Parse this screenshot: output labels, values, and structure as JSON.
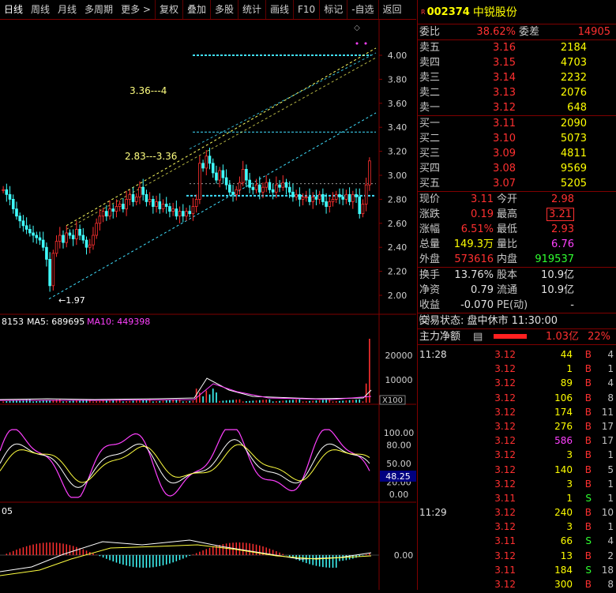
{
  "toolbar": {
    "tabs": [
      "日线",
      "周线",
      "月线",
      "多周期",
      "更多 >"
    ],
    "tools": [
      "复权",
      "叠加",
      "多股",
      "统计",
      "画线",
      "F10",
      "标记",
      "-自选",
      "返回"
    ]
  },
  "price_axis": [
    "4.00",
    "3.80",
    "3.60",
    "3.40",
    "3.20",
    "3.00",
    "2.80",
    "2.60",
    "2.40",
    "2.20",
    "2.00"
  ],
  "annotations": {
    "top_range": "3.36---4",
    "mid_range": "2.83---3.36",
    "low_mark": "1.97"
  },
  "volume_panel": {
    "legend_vol": "8153",
    "legend_ma5": "MA5: 689695",
    "legend_ma10": "MA10: 449398",
    "axis": [
      "20000",
      "10000"
    ],
    "unit": "X100"
  },
  "kdj_panel": {
    "axis": [
      "100.00",
      "80.00",
      "50.00",
      "20.00",
      "0.00"
    ],
    "current": "48.25"
  },
  "macd_panel": {
    "legend": "05",
    "axis": "0.00"
  },
  "stock": {
    "flag": "R",
    "code": "002374",
    "name": "中锐股份"
  },
  "order": {
    "weibi_label": "委比",
    "weibi": "38.62%",
    "weicha_label": "委差",
    "weicha": "14905"
  },
  "asks": [
    {
      "label": "卖五",
      "price": "3.16",
      "vol": "2184"
    },
    {
      "label": "卖四",
      "price": "3.15",
      "vol": "4703"
    },
    {
      "label": "卖三",
      "price": "3.14",
      "vol": "2232"
    },
    {
      "label": "卖二",
      "price": "3.13",
      "vol": "2076"
    },
    {
      "label": "卖一",
      "price": "3.12",
      "vol": "648"
    }
  ],
  "bids": [
    {
      "label": "买一",
      "price": "3.11",
      "vol": "2090"
    },
    {
      "label": "买二",
      "price": "3.10",
      "vol": "5073"
    },
    {
      "label": "买三",
      "price": "3.09",
      "vol": "4811"
    },
    {
      "label": "买四",
      "price": "3.08",
      "vol": "9569"
    },
    {
      "label": "买五",
      "price": "3.07",
      "vol": "5205"
    }
  ],
  "quote": [
    {
      "l1": "现价",
      "v1": "3.11",
      "l2": "今开",
      "v2": "2.98"
    },
    {
      "l1": "涨跌",
      "v1": "0.19",
      "l2": "最高",
      "v2": "3.21"
    },
    {
      "l1": "涨幅",
      "v1": "6.51%",
      "l2": "最低",
      "v2": "2.93"
    },
    {
      "l1": "总量",
      "v1": "149.3万",
      "l2": "量比",
      "v2": "6.76"
    },
    {
      "l1": "外盘",
      "v1": "573616",
      "l2": "内盘",
      "v2": "919537"
    }
  ],
  "finance": [
    {
      "l1": "换手",
      "v1": "13.76%",
      "l2": "股本",
      "v2": "10.9亿"
    },
    {
      "l1": "净资",
      "v1": "0.79",
      "l2": "流通",
      "v2": "10.9亿"
    },
    {
      "l1": "收益㈢",
      "v1": "-0.070",
      "l2": "PE(动)",
      "v2": "-"
    }
  ],
  "trade_status": "交易状态: 盘中休市 11:30:00",
  "main_flow": {
    "label": "主力净额",
    "value": "1.03亿",
    "pct": "22%"
  },
  "ticks": [
    {
      "t": "11:28",
      "p": "3.12",
      "v": "44",
      "bs": "B",
      "n": "4"
    },
    {
      "t": "",
      "p": "3.12",
      "v": "1",
      "bs": "B",
      "n": "1"
    },
    {
      "t": "",
      "p": "3.12",
      "v": "89",
      "bs": "B",
      "n": "4"
    },
    {
      "t": "",
      "p": "3.12",
      "v": "106",
      "bs": "B",
      "n": "8"
    },
    {
      "t": "",
      "p": "3.12",
      "v": "174",
      "bs": "B",
      "n": "11"
    },
    {
      "t": "",
      "p": "3.12",
      "v": "276",
      "bs": "B",
      "n": "17"
    },
    {
      "t": "",
      "p": "3.12",
      "v": "586",
      "bs": "B",
      "n": "17"
    },
    {
      "t": "",
      "p": "3.12",
      "v": "3",
      "bs": "B",
      "n": "1"
    },
    {
      "t": "",
      "p": "3.12",
      "v": "140",
      "bs": "B",
      "n": "5"
    },
    {
      "t": "",
      "p": "3.12",
      "v": "3",
      "bs": "B",
      "n": "1"
    },
    {
      "t": "",
      "p": "3.11",
      "v": "1",
      "bs": "S",
      "n": "1"
    },
    {
      "t": "11:29",
      "p": "3.12",
      "v": "240",
      "bs": "B",
      "n": "10"
    },
    {
      "t": "",
      "p": "3.12",
      "v": "3",
      "bs": "B",
      "n": "1"
    },
    {
      "t": "",
      "p": "3.11",
      "v": "66",
      "bs": "S",
      "n": "4"
    },
    {
      "t": "",
      "p": "3.12",
      "v": "13",
      "bs": "B",
      "n": "2"
    },
    {
      "t": "",
      "p": "3.11",
      "v": "184",
      "bs": "S",
      "n": "18"
    },
    {
      "t": "",
      "p": "3.12",
      "v": "300",
      "bs": "B",
      "n": "8"
    }
  ]
}
